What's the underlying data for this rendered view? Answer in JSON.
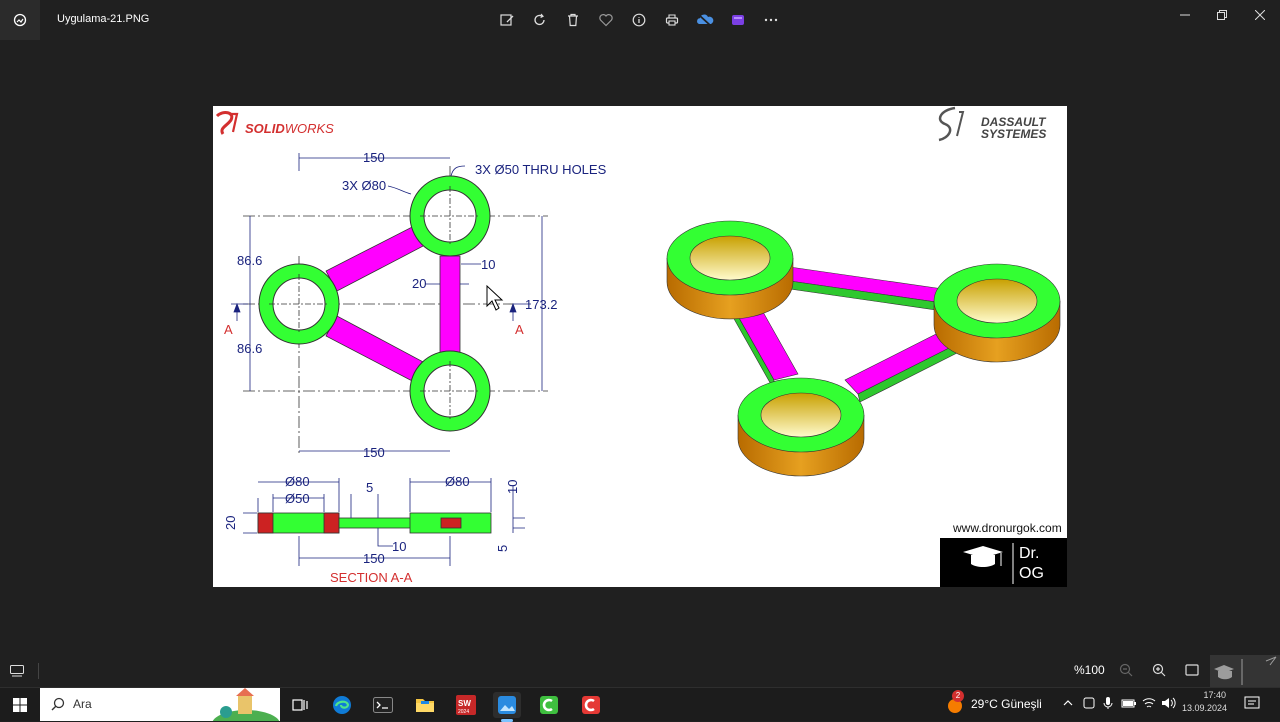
{
  "window": {
    "title": "Uygulama-21.PNG",
    "toolbar": [
      {
        "name": "edit-icon"
      },
      {
        "name": "rotate-icon"
      },
      {
        "name": "delete-icon"
      },
      {
        "name": "favorite-icon"
      },
      {
        "name": "info-icon"
      },
      {
        "name": "print-icon"
      },
      {
        "name": "onedrive-icon"
      },
      {
        "name": "clipchamp-icon"
      },
      {
        "name": "more-icon"
      }
    ]
  },
  "drawing": {
    "brand_left": "SOLIDWORKS",
    "brand_left_a": "SOLID",
    "brand_left_b": "WORKS",
    "brand_right_1": "DASSAULT",
    "brand_right_2": "SYSTEMES",
    "dims": {
      "top_150": "150",
      "holes": "3X Ø50 THRU HOLES",
      "od": "3X Ø80",
      "d866_top": "86.6",
      "d866_bot": "86.6",
      "d10": "10",
      "d20": "20",
      "d1732": "173.2",
      "bottom_150": "150",
      "section_a_left": "A",
      "section_a_right": "A"
    },
    "section": {
      "d80_left": "Ø80",
      "d50": "Ø50",
      "d5_top": "5",
      "d80_right": "Ø80",
      "d10_right": "10",
      "d20": "20",
      "d10_bottom": "10",
      "d150": "150",
      "d5_right": "5",
      "label": "SECTION A-A"
    },
    "website": "www.dronurgok.com",
    "logo_line1": "Dr.",
    "logo_line2": "OG"
  },
  "status": {
    "zoom": "%100"
  },
  "taskbar": {
    "search_placeholder": "Ara",
    "weather_badge": "2",
    "weather": "29°C  Güneşli",
    "time": "17:40",
    "date": "13.09.2024",
    "sw_badge": "2024"
  },
  "colors": {
    "green": "#33ff33",
    "magenta": "#ff00ff",
    "orange": "#e08a00",
    "dim_blue": "#1a237e",
    "section_red": "#d32f2f"
  }
}
